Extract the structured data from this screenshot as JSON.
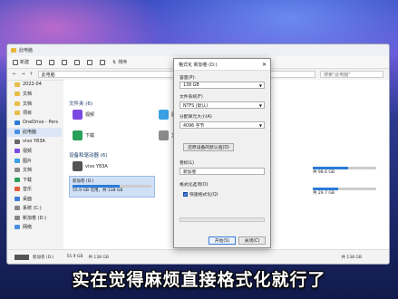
{
  "explorer": {
    "title": "此电脑",
    "toolbar": {
      "new": "新建",
      "sort": "排序",
      "view": "查看"
    },
    "address": "此电脑",
    "search_placeholder": "搜索\"此电脑\"",
    "sidebar": [
      {
        "label": "2022-04"
      },
      {
        "label": "文档"
      },
      {
        "label": "文档"
      },
      {
        "label": "项目"
      },
      {
        "label": "OneDrive - Pers"
      },
      {
        "label": "此电脑"
      },
      {
        "label": "vivo Y83A"
      },
      {
        "label": "视频"
      },
      {
        "label": "图片"
      },
      {
        "label": "文档"
      },
      {
        "label": "下载"
      },
      {
        "label": "音乐"
      },
      {
        "label": "桌面"
      },
      {
        "label": "系统 (C:)"
      },
      {
        "label": "新加卷 (D:)"
      },
      {
        "label": "网络"
      }
    ],
    "folders_header": "文件夹 (6)",
    "folders": [
      {
        "label": "视频"
      },
      {
        "label": "图片"
      },
      {
        "label": "下载"
      },
      {
        "label": "文档"
      }
    ],
    "devices_header": "设备和驱动器 (6)",
    "device_phone": "vivo Y83A",
    "drive_d": {
      "label": "新加卷 (D:)",
      "size": "55.9 GB 可用，共 138 GB",
      "fill": 0.6
    },
    "drive_r1": {
      "size": "共 98.6 GB",
      "fill": 0.55
    },
    "drive_r2": {
      "size": "共 29.7 GB",
      "fill": 0.4
    },
    "status_drive": {
      "label": "新加卷 (D:)",
      "size": "55.9 GB",
      "total": "共 138 GB"
    },
    "status_right": "共 138 GB"
  },
  "dialog": {
    "title": "格式化 新加卷 (D:)",
    "capacity_label": "容量(P):",
    "capacity_value": "138 GB",
    "fs_label": "文件系统(F)",
    "fs_value": "NTFS (默认)",
    "alloc_label": "分配单元大小(A)",
    "alloc_value": "4096 字节",
    "restore_defaults": "还原设备的默认值(D)",
    "volume_label": "卷标(L)",
    "volume_value": "新加卷",
    "options_label": "格式化选项(O)",
    "quick_format": "快速格式化(Q)",
    "start_button": "开始(S)",
    "close_button": "关闭(C)"
  },
  "subtitle": "实在觉得麻烦直接格式化就行了"
}
